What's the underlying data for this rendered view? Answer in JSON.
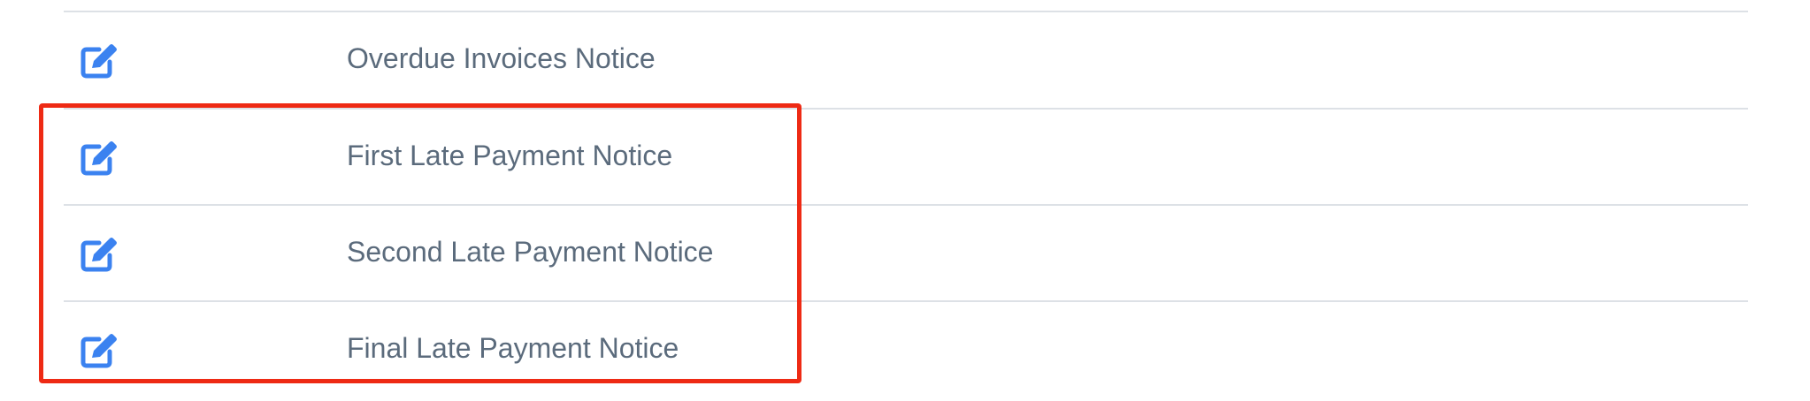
{
  "notices": [
    {
      "label": "Overdue Invoices Notice",
      "icon": "edit-icon"
    },
    {
      "label": "First Late Payment Notice",
      "icon": "edit-icon"
    },
    {
      "label": "Second Late Payment Notice",
      "icon": "edit-icon"
    },
    {
      "label": "Final Late Payment Notice",
      "icon": "edit-icon"
    }
  ],
  "colors": {
    "icon": "#3b82f0",
    "text": "#5b6b7c",
    "divider": "#dde1e6",
    "highlight": "#ee2a14"
  }
}
